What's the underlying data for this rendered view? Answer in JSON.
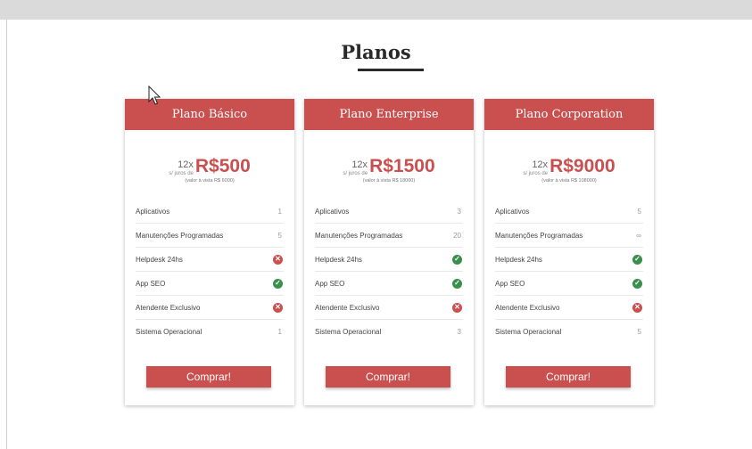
{
  "page": {
    "title": "Planos"
  },
  "plans": [
    {
      "name": "Plano Básico",
      "installments": "12x",
      "no_interest": "s/ juros de",
      "price": "R$500",
      "full_price": "(valor à vista R$ 6000)",
      "features": [
        {
          "label": "Aplicativos",
          "value": "1"
        },
        {
          "label": "Manutenções Programadas",
          "value": "5"
        },
        {
          "label": "Helpdesk 24hs",
          "included": false
        },
        {
          "label": "App SEO",
          "included": true
        },
        {
          "label": "Atendente Exclusivo",
          "included": false
        },
        {
          "label": "Sistema Operacional",
          "value": "1"
        }
      ],
      "button": "Comprar!"
    },
    {
      "name": "Plano Enterprise",
      "installments": "12x",
      "no_interest": "s/ juros de",
      "price": "R$1500",
      "full_price": "(valor à vista R$ 18000)",
      "features": [
        {
          "label": "Aplicativos",
          "value": "3"
        },
        {
          "label": "Manutenções Programadas",
          "value": "20"
        },
        {
          "label": "Helpdesk 24hs",
          "included": true
        },
        {
          "label": "App SEO",
          "included": true
        },
        {
          "label": "Atendente Exclusivo",
          "included": false
        },
        {
          "label": "Sistema Operacional",
          "value": "3"
        }
      ],
      "button": "Comprar!"
    },
    {
      "name": "Plano Corporation",
      "installments": "12x",
      "no_interest": "s/ juros de",
      "price": "R$9000",
      "full_price": "(valor à vista R$ 108000)",
      "features": [
        {
          "label": "Aplicativos",
          "value": "5"
        },
        {
          "label": "Manutenções Programadas",
          "value": "∞"
        },
        {
          "label": "Helpdesk 24hs",
          "included": true
        },
        {
          "label": "App SEO",
          "included": true
        },
        {
          "label": "Atendente Exclusivo",
          "included": false
        },
        {
          "label": "Sistema Operacional",
          "value": "5"
        }
      ],
      "button": "Comprar!"
    }
  ],
  "icons": {
    "included": "check-circle-icon",
    "not_included": "x-circle-icon"
  },
  "colors": {
    "accent": "#c9504f",
    "check": "#3a8f4c"
  }
}
